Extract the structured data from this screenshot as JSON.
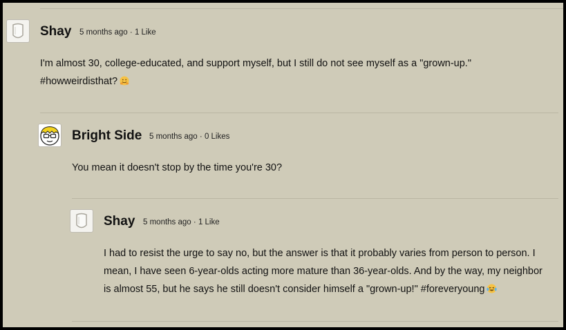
{
  "comments": [
    {
      "author": "Shay",
      "time": "5 months ago",
      "separator": "·",
      "likes": "1 Like",
      "lines": [
        "I'm almost 30, college-educated, and support myself, but I still do not see myself as a \"grown-up.\"",
        "#howweirdisthat?"
      ],
      "emoji": "hugging-face-emoji"
    },
    {
      "author": "Bright Side",
      "time": "5 months ago",
      "separator": "·",
      "likes": "0 Likes",
      "lines": [
        "You mean it doesn't stop by the time you're 30?"
      ]
    },
    {
      "author": "Shay",
      "time": "5 months ago",
      "separator": "·",
      "likes": "1 Like",
      "lines": [
        "I had to resist the urge to say no, but the answer is that it probably varies from person to person. I",
        "mean, I have seen 6-year-olds acting more mature than 36-year-olds. And by the way, my neighbor",
        "is almost 55, but he says he still doesn't consider himself a \"grown-up!\" #foreveryoung"
      ],
      "emoji": "laughing-tears-emoji"
    }
  ],
  "colors": {
    "background": "#cfcbb8",
    "divider": "#b9b5a3",
    "text": "#111111"
  }
}
